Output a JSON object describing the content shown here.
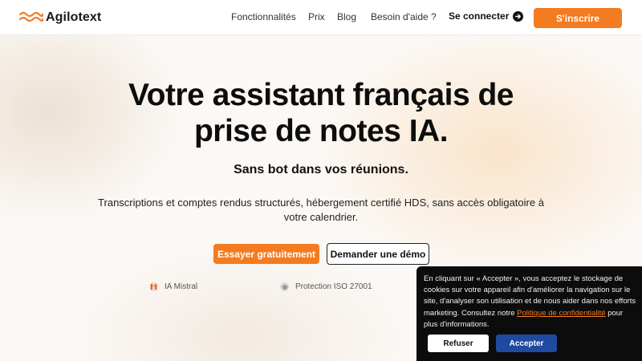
{
  "header": {
    "logo_text": "Agilotext",
    "nav": [
      {
        "label": "Fonctionnalités"
      },
      {
        "label": "Prix"
      },
      {
        "label": "Blog"
      },
      {
        "label": "Besoin d'aide ?"
      }
    ],
    "connect_label": "Se connecter",
    "signup_label": "S'inscrire"
  },
  "hero": {
    "title_line1": "Votre assistant français de",
    "title_line2": "prise de notes IA.",
    "subtitle": "Sans bot dans vos réunions.",
    "description_line1": "Transcriptions et comptes rendus structurés, hébergement certifié HDS, sans accès obligatoire à",
    "description_line2": "votre calendrier.",
    "try_label": "Essayer gratuitement",
    "demo_label": "Demander une démo"
  },
  "features": [
    {
      "label": "IA Mistral",
      "icon": "mistral-icon"
    },
    {
      "label": "Protection ISO 27001",
      "icon": "shield-icon"
    }
  ],
  "cookie": {
    "text_before": "En cliquant sur « Accepter », vous acceptez le stockage de cookies sur votre appareil afin d'améliorer la navigation sur le site, d'analyser son utilisation et de nous aider dans nos efforts marketing. Consultez notre ",
    "link_text": "Politique de confidentialité",
    "text_after": " pour plus d'informations.",
    "refuse_label": "Refuser",
    "accept_label": "Accepter"
  },
  "colors": {
    "accent": "#f47b20",
    "accept_button": "#1f4aa0",
    "banner_bg": "#0c0c0c"
  }
}
